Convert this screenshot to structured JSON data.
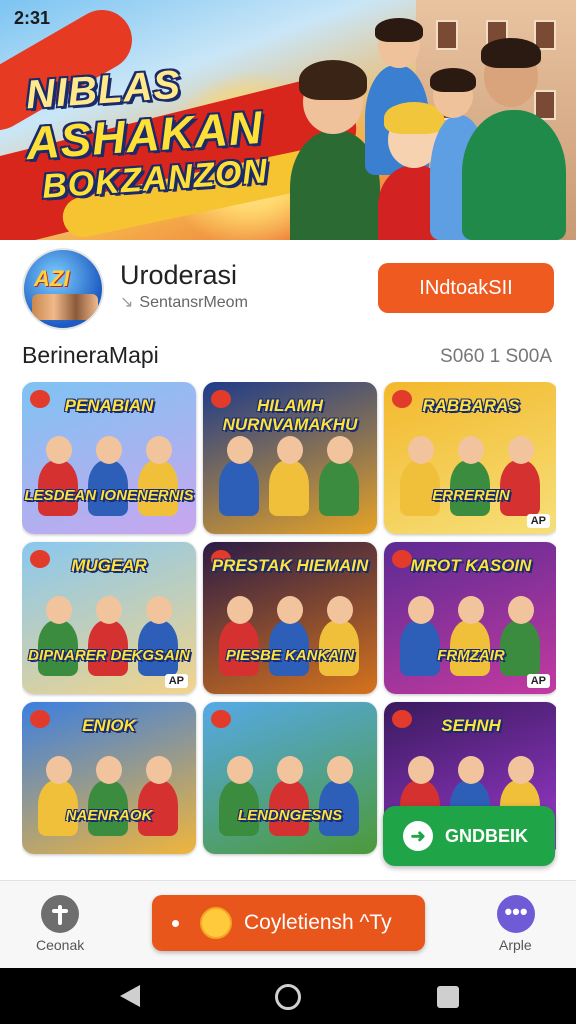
{
  "status": {
    "time": "2:31"
  },
  "banner": {
    "line1": "NIBLAS",
    "line2": "ASHAKAN",
    "line3": "BOKZANZON"
  },
  "app": {
    "name": "Uroderasi",
    "developer": "SentansrMeom",
    "install_label": "INdtoakSII"
  },
  "section": {
    "title": "BerineraMapi",
    "meta": "S060 1 S00A"
  },
  "cards": [
    {
      "title_top": "PENABIAN",
      "title_bottom": "LESDEAN IONENERNIS",
      "tag": "",
      "palette": [
        "#7ec3f2",
        "#c9a6ef"
      ]
    },
    {
      "title_top": "HILAMH NURNVAMAKHU",
      "title_bottom": "",
      "tag": "",
      "palette": [
        "#1e3b8a",
        "#e6a326"
      ]
    },
    {
      "title_top": "RABBARAS",
      "title_bottom": "ERREREIN",
      "tag": "AP",
      "palette": [
        "#f3b82c",
        "#f6e07a"
      ]
    },
    {
      "title_top": "MUGEAR",
      "title_bottom": "DIPNARER DEKGSAIN",
      "tag": "AP",
      "palette": [
        "#89c8f0",
        "#f2d48a"
      ]
    },
    {
      "title_top": "PRESTAK HIEMAIN",
      "title_bottom": "PIESBE KANKAIN",
      "tag": "",
      "palette": [
        "#2b1c45",
        "#d5731d"
      ]
    },
    {
      "title_top": "MROT KASOIN",
      "title_bottom": "FRMZAIR",
      "tag": "AP",
      "palette": [
        "#5b2b93",
        "#c43aa0"
      ]
    },
    {
      "title_top": "ENIOK",
      "title_bottom": "NAENRAOK",
      "tag": "",
      "palette": [
        "#3b7fe0",
        "#f0b53c"
      ]
    },
    {
      "title_top": "",
      "title_bottom": "LENDNGESNS",
      "tag": "",
      "palette": [
        "#56a9e6",
        "#4c9a3a"
      ]
    },
    {
      "title_top": "SEHNH",
      "title_bottom": "",
      "tag": "",
      "palette": [
        "#3a1a5e",
        "#9d3ad0"
      ]
    }
  ],
  "fab": {
    "label": "GNDBEIK",
    "icon": "right-arrow-icon"
  },
  "bottom_bar": {
    "left_label": "Ceonak",
    "main_button_label": "Coyletiensh ^Ty",
    "right_label": "Arple"
  },
  "colors": {
    "accent": "#ee5a1f",
    "green": "#1fa548",
    "purple": "#6f5bd6"
  }
}
